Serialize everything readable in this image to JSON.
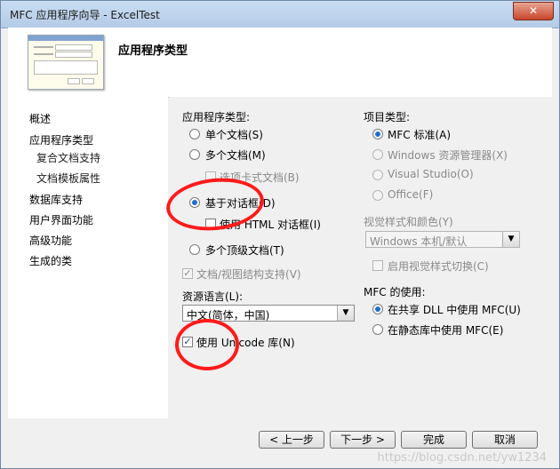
{
  "window": {
    "title": "MFC 应用程序向导 - ExcelTest",
    "close_glyph": "✕"
  },
  "header": {
    "title": "应用程序类型"
  },
  "sidebar": {
    "items": [
      {
        "label": "概述"
      },
      {
        "label": "应用程序类型"
      },
      {
        "label": "复合文档支持"
      },
      {
        "label": "文档模板属性"
      },
      {
        "label": "数据库支持"
      },
      {
        "label": "用户界面功能"
      },
      {
        "label": "高级功能"
      },
      {
        "label": "生成的类"
      }
    ]
  },
  "app_type": {
    "group_label": "应用程序类型:",
    "single_doc": {
      "label": "单个文档(S)",
      "selected": false
    },
    "multi_doc": {
      "label": "多个文档(M)",
      "selected": false
    },
    "tabbed_docs": {
      "label": "选项卡式文档(B)",
      "checked": false,
      "enabled": false
    },
    "dialog_based": {
      "label": "基于对话框(D)",
      "selected": true
    },
    "html_dialog": {
      "label": "使用 HTML 对话框(I)",
      "checked": false,
      "enabled": true
    },
    "multi_top": {
      "label": "多个顶级文档(T)",
      "selected": false
    },
    "doc_view": {
      "label": "文档/视图结构支持(V)",
      "checked": true,
      "enabled": false
    }
  },
  "resource_lang": {
    "label": "资源语言(L):",
    "value": "中文(简体，中国)"
  },
  "unicode": {
    "label": "使用 Unicode 库(N)",
    "checked": true
  },
  "project_type": {
    "group_label": "项目类型:",
    "mfc_standard": {
      "label": "MFC 标准(A)",
      "selected": true
    },
    "windows_explorer": {
      "label": "Windows 资源管理器(X)",
      "enabled": false
    },
    "visual_studio": {
      "label": "Visual Studio(O)",
      "enabled": false
    },
    "office": {
      "label": "Office(F)",
      "enabled": false
    }
  },
  "visual_style": {
    "label": "视觉样式和颜色(Y)",
    "value": "Windows 本机/默认",
    "enable_switch": {
      "label": "启用视觉样式切换(C)",
      "checked": false,
      "enabled": false
    }
  },
  "mfc_use": {
    "group_label": "MFC 的使用:",
    "shared_dll": {
      "label": "在共享 DLL 中使用 MFC(U)",
      "selected": true
    },
    "static_lib": {
      "label": "在静态库中使用 MFC(E)",
      "selected": false
    }
  },
  "buttons": {
    "prev": "< 上一步",
    "next": "下一步 >",
    "finish": "完成",
    "cancel": "取消"
  },
  "watermark": "https://blog.csdn.net/yw1234",
  "icons": {
    "check_glyph": "✓",
    "combo_arrow": "▼"
  },
  "colors": {
    "annotation": "#ff1a1a",
    "radio_dot": "#1e6fd0"
  }
}
